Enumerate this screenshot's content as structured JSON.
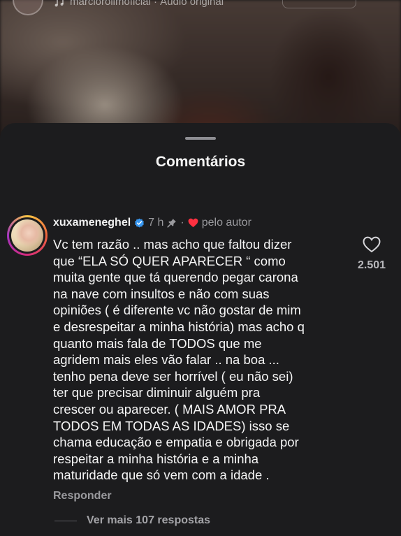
{
  "video": {
    "audio_label": "marciorolimoficial · Áudio original",
    "audio_icon": "music-note-icon"
  },
  "comments_sheet": {
    "title": "Comentários"
  },
  "comment": {
    "username": "xuxameneghel",
    "verified_icon": "verified-badge-icon",
    "time": "7 h",
    "pinned_icon": "pin-icon",
    "separator": "·",
    "liked_by_author_label": "pelo autor",
    "liked_by_author_color": "#ff3040",
    "text": "Vc tem razão .. mas acho que faltou dizer\nque “ELA SÓ QUER APARECER “ como\nmuita gente que tá querendo pegar carona\nna nave com insultos e não com suas\nopiniões ( é diferente vc não gostar de mim\ne desrespeitar a minha história) mas acho q\nquanto mais fala de TODOS que me\nagridem mais eles vão falar .. na boa ...\ntenho pena deve ser horrível ( eu não sei)\nter que precisar diminuir alguém pra\ncrescer ou aparecer. ( MAIS AMOR PRA\nTODOS EM TODAS AS IDADES) isso se\nchama educação e empatia  e obrigada por\nrespeitar a minha história e a minha\nmaturidade que só vem com a idade .",
    "reply_label": "Responder",
    "like_count": "2.501",
    "like_icon": "heart-outline-icon",
    "more_replies_label": "Ver mais 107 respostas"
  },
  "colors": {
    "sheet_background": "#1c1c1e",
    "verified_blue": "#3897f0"
  }
}
